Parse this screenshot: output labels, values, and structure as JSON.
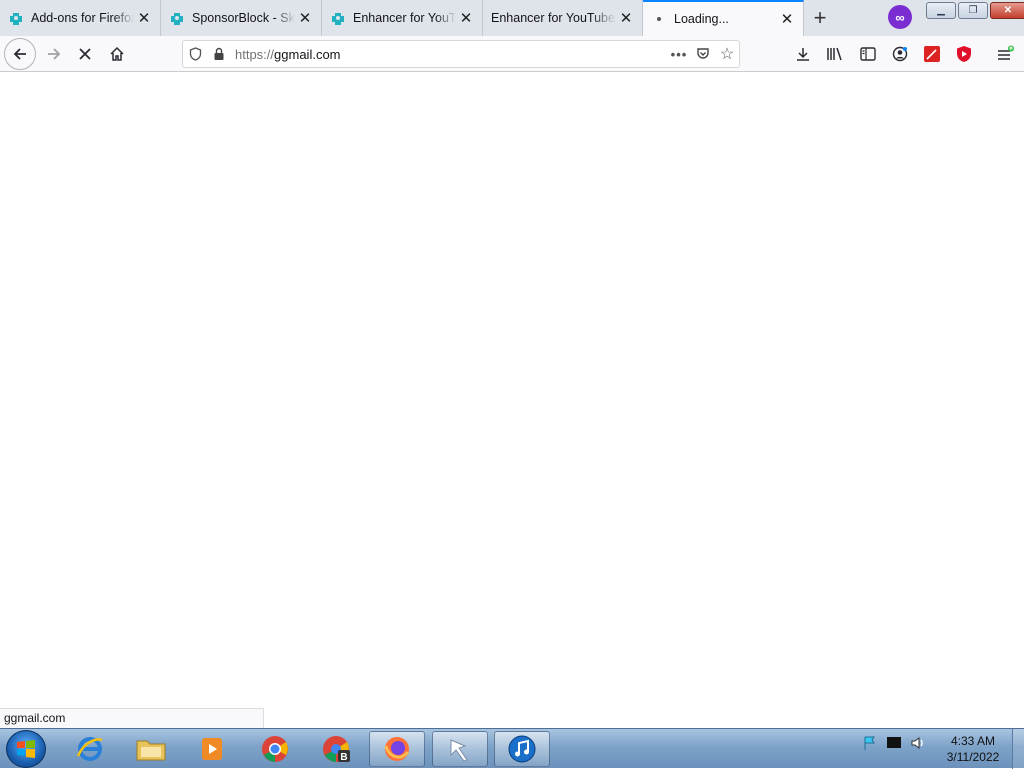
{
  "tabs": [
    {
      "title": "Add-ons for Firefox",
      "icon": "puzzle-icon"
    },
    {
      "title": "SponsorBlock - Skip",
      "icon": "puzzle-icon"
    },
    {
      "title": "Enhancer for YouTube",
      "icon": "puzzle-icon"
    },
    {
      "title": "Enhancer for YouTube™",
      "icon": "none"
    },
    {
      "title": "Loading...",
      "icon": "loading-dot"
    }
  ],
  "url": {
    "scheme": "https://",
    "host": "ggmail.com"
  },
  "status_text": "ggmail.com",
  "clock": {
    "time": "4:33 AM",
    "date": "3/11/2022"
  },
  "colors": {
    "accent": "#0a84ff",
    "private": "#7a2ed1",
    "addon_teal": "#20b2c0"
  }
}
